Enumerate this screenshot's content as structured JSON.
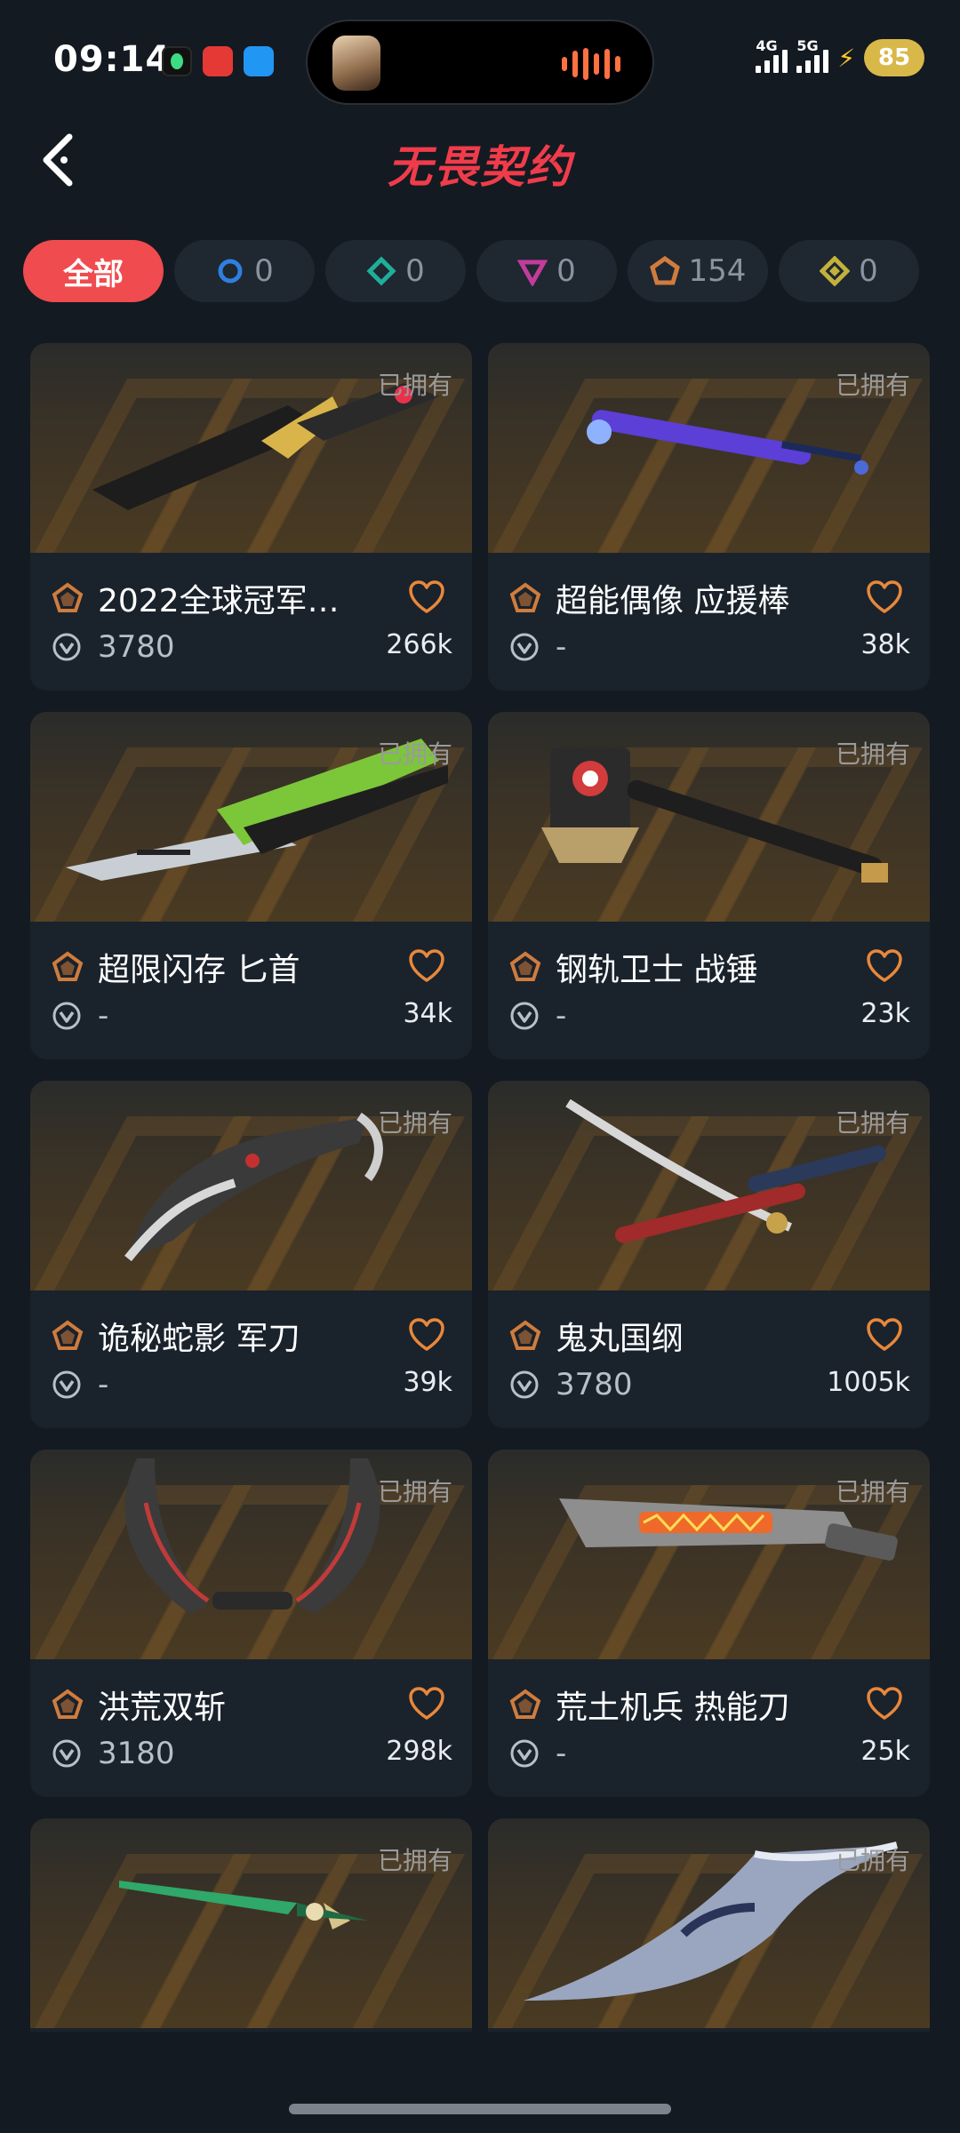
{
  "status_bar": {
    "time": "09:14",
    "net1": "4G",
    "net2": "5G",
    "battery": "85"
  },
  "header": {
    "title": "无畏契约"
  },
  "filters": [
    {
      "label": "全部",
      "icon": "all",
      "color": "#f04b4f"
    },
    {
      "label": "0",
      "icon": "circle-gem-icon",
      "color": "#2f7fe0"
    },
    {
      "label": "0",
      "icon": "diamond-gem-icon",
      "color": "#1fae9a"
    },
    {
      "label": "0",
      "icon": "triangle-gem-icon",
      "color": "#c23c9c"
    },
    {
      "label": "154",
      "icon": "pentagon-gem-icon",
      "color": "#d07c3c"
    },
    {
      "label": "0",
      "icon": "rhombus-gem-icon",
      "color": "#c2b23c"
    }
  ],
  "cards": [
    {
      "owned": "已拥有",
      "name": "2022全球冠军…",
      "price": "3780",
      "likes": "266k",
      "weapon": "champions-knife-icon"
    },
    {
      "owned": "已拥有",
      "name": "超能偶像 应援棒",
      "price": "-",
      "likes": "38k",
      "weapon": "glow-stick-icon"
    },
    {
      "owned": "已拥有",
      "name": "超限闪存 匕首",
      "price": "-",
      "likes": "34k",
      "weapon": "green-dagger-icon"
    },
    {
      "owned": "已拥有",
      "name": "钢轨卫士 战锤",
      "price": "-",
      "likes": "23k",
      "weapon": "war-hammer-icon"
    },
    {
      "owned": "已拥有",
      "name": "诡秘蛇影 军刀",
      "price": "-",
      "likes": "39k",
      "weapon": "karambit-icon"
    },
    {
      "owned": "已拥有",
      "name": "鬼丸国纲",
      "price": "3780",
      "likes": "1005k",
      "weapon": "katana-icon"
    },
    {
      "owned": "已拥有",
      "name": "洪荒双斩",
      "price": "3180",
      "likes": "298k",
      "weapon": "twin-blades-icon"
    },
    {
      "owned": "已拥有",
      "name": "荒土机兵 热能刀",
      "price": "-",
      "likes": "25k",
      "weapon": "thermal-blade-icon"
    },
    {
      "owned": "已拥有",
      "name": "",
      "price": "",
      "likes": "",
      "weapon": "green-sword-icon"
    },
    {
      "owned": "已拥有",
      "name": "",
      "price": "",
      "likes": "",
      "weapon": "curved-blade-icon"
    }
  ],
  "colors": {
    "accent": "#f04b4f",
    "title": "#f03c4a",
    "tier_select": "#d07c3c",
    "heart": "#e8883a"
  }
}
